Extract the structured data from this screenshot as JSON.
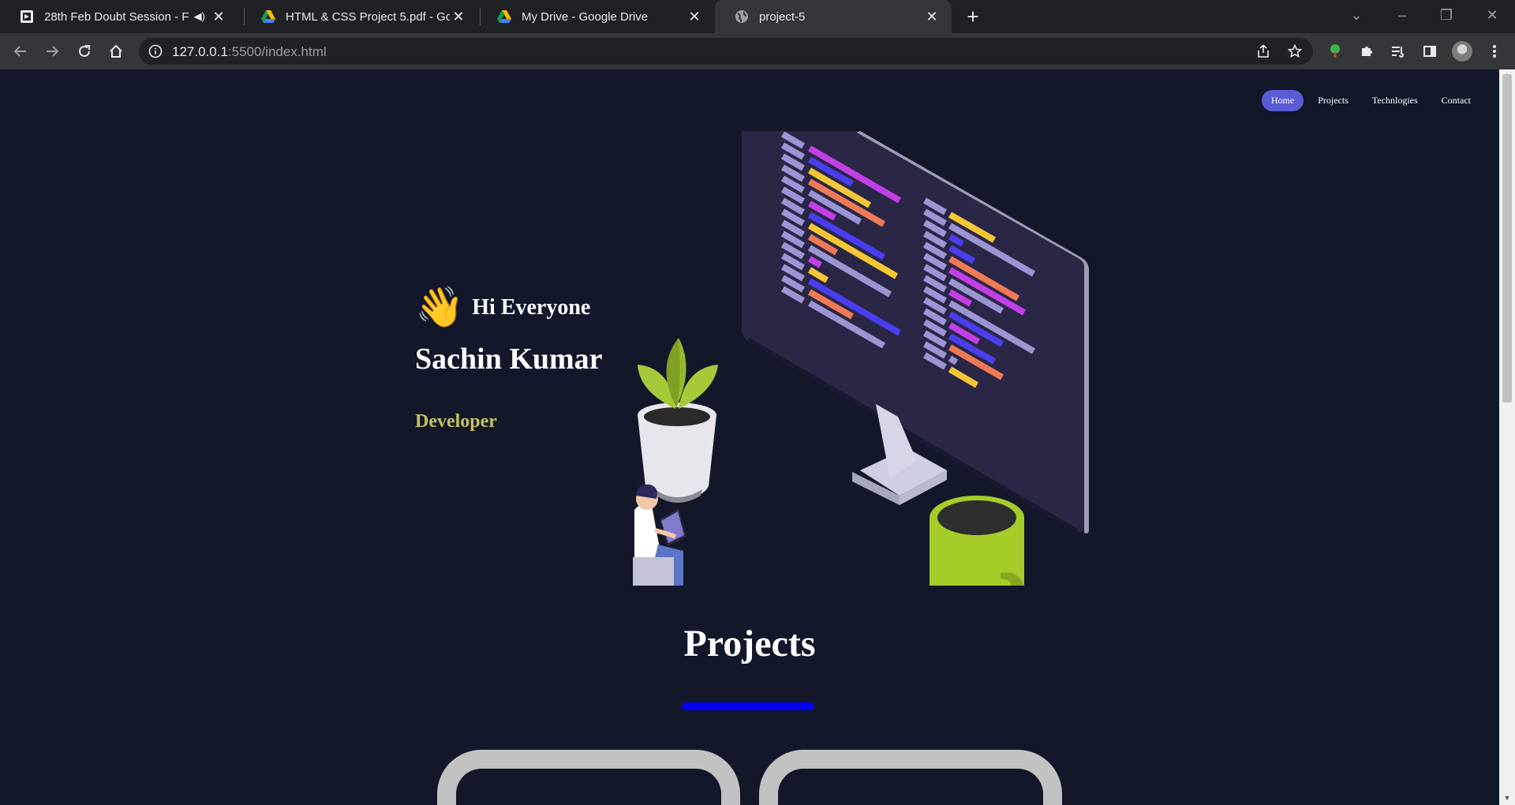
{
  "browser": {
    "tabs": [
      {
        "title": "28th Feb Doubt Session - Full",
        "icon": "video-icon",
        "audio": true,
        "active": false
      },
      {
        "title": "HTML & CSS Project 5.pdf - Google Drive",
        "icon": "drive-icon",
        "active": false
      },
      {
        "title": "My Drive - Google Drive",
        "icon": "drive-icon",
        "active": false
      },
      {
        "title": "project-5",
        "icon": "globe-icon",
        "active": true
      }
    ],
    "url_host": "127.0.0.1",
    "url_path": ":5500/index.html"
  },
  "nav": {
    "items": [
      "Home",
      "Projects",
      "Technlogies",
      "Contact"
    ],
    "active": "Home"
  },
  "hero": {
    "wave_emoji": "👋",
    "greeting": "Hi Everyone",
    "name": "Sachin Kumar",
    "role": "Developer"
  },
  "projects": {
    "title": "Projects"
  },
  "colors": {
    "page_bg": "#121829",
    "nav_active": "#5b5bd8",
    "role_text": "#c5c05a",
    "underline": "#0000ee",
    "card_border": "#c2c2c2"
  }
}
